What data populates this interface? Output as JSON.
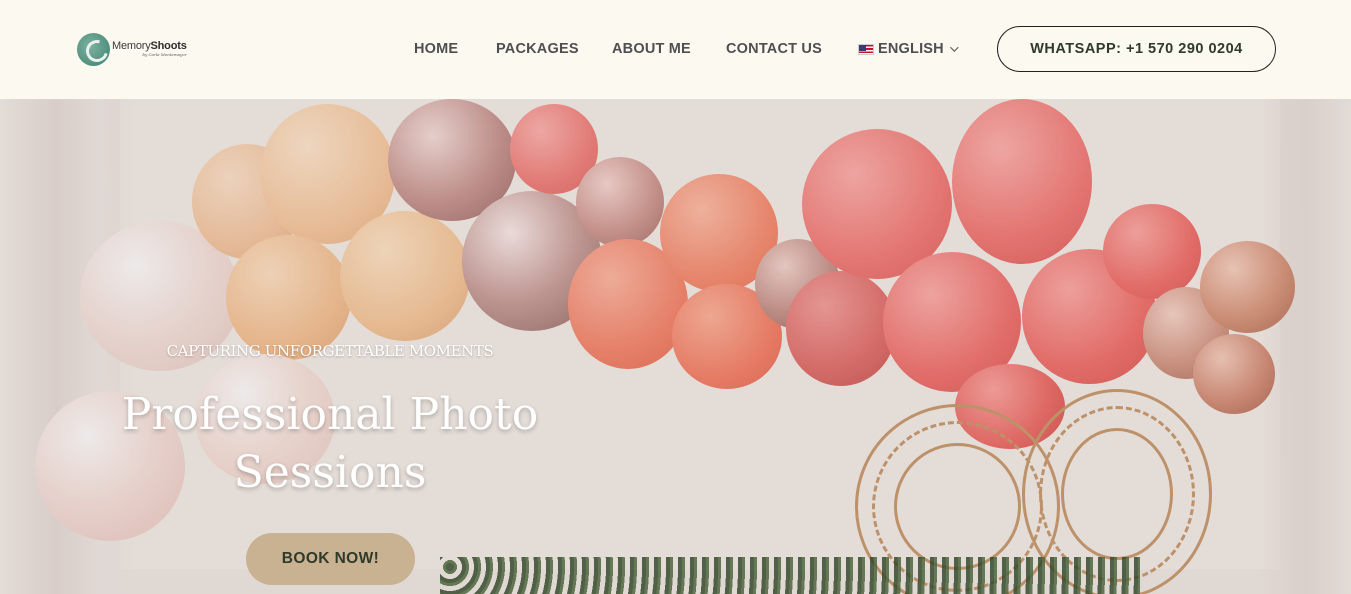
{
  "header": {
    "logo": {
      "name_light": "Memory",
      "name_bold": "Shoots",
      "tagline": "by Carla Montemayor"
    },
    "nav": [
      {
        "label": "HOME"
      },
      {
        "label": "PACKAGES"
      },
      {
        "label": "ABOUT ME"
      },
      {
        "label": "CONTACT US"
      }
    ],
    "language": {
      "label": "ENGLISH",
      "flag": "us-flag-icon"
    },
    "whatsapp_button": "WHATSAPP: +1 570 290 0204"
  },
  "hero": {
    "eyebrow": "CAPTURING UNFORGETTABLE MOMENTS",
    "headline_line1": "Professional Photo",
    "headline_line2": "Sessions",
    "cta": "BOOK NOW!"
  },
  "colors": {
    "header_bg": "#fcf9f1",
    "nav_text": "#4f4f52",
    "cta_bg": "#c9b291",
    "cta_text": "#2f3a2a",
    "logo_accent": "#4f8f7d"
  }
}
